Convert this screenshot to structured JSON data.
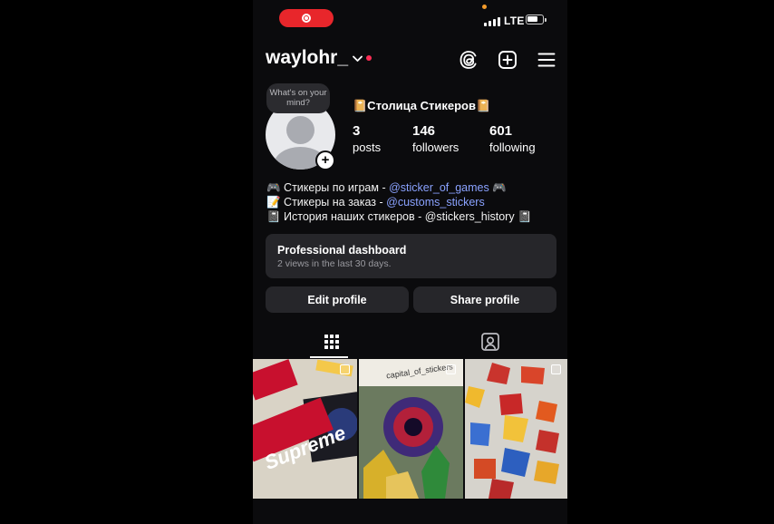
{
  "status_bar": {
    "carrier": "LTE",
    "recording_icon": "screen-record-icon"
  },
  "header": {
    "username": "waylohr_",
    "icons": [
      "threads-icon",
      "create-plus-icon",
      "menu-icon"
    ]
  },
  "profile": {
    "note_bubble": "What's on your mind?",
    "display_name": "📔Столица Стикеров📔",
    "stats": [
      {
        "value": "3",
        "label": "posts"
      },
      {
        "value": "146",
        "label": "followers"
      },
      {
        "value": "601",
        "label": "following"
      }
    ]
  },
  "bio": {
    "lines": [
      {
        "prefix": "🎮 Стикеры по играм - ",
        "link": "@sticker_of_games",
        "suffix": " 🎮"
      },
      {
        "prefix": "📝 Стикеры на заказ - ",
        "link": "@customs_stickers",
        "suffix": ""
      },
      {
        "prefix": "📓 История наших стикеров - @stickers_history 📓",
        "link": "",
        "suffix": ""
      }
    ]
  },
  "dashboard": {
    "title": "Professional dashboard",
    "subtitle": "2 views in the last 30 days."
  },
  "actions": {
    "edit": "Edit profile",
    "share": "Share profile"
  },
  "tabs": [
    {
      "icon": "grid-icon",
      "selected": true
    },
    {
      "icon": "tagged-person-icon",
      "selected": false
    }
  ],
  "posts": [
    {
      "label": "Supreme",
      "colors": [
        "#d9d3c6",
        "#c8102e"
      ]
    },
    {
      "label": "capital_of_stickers",
      "colors": [
        "#6b7a5f",
        "#3f2a78"
      ]
    },
    {
      "label": "",
      "colors": [
        "#d6d3cc",
        "#c9342d"
      ]
    }
  ],
  "colors": {
    "background": "#0b0b0d",
    "card": "#26262a",
    "link": "#8aa2ff",
    "recording": "#e8262b",
    "notification": "#ff2d55"
  }
}
